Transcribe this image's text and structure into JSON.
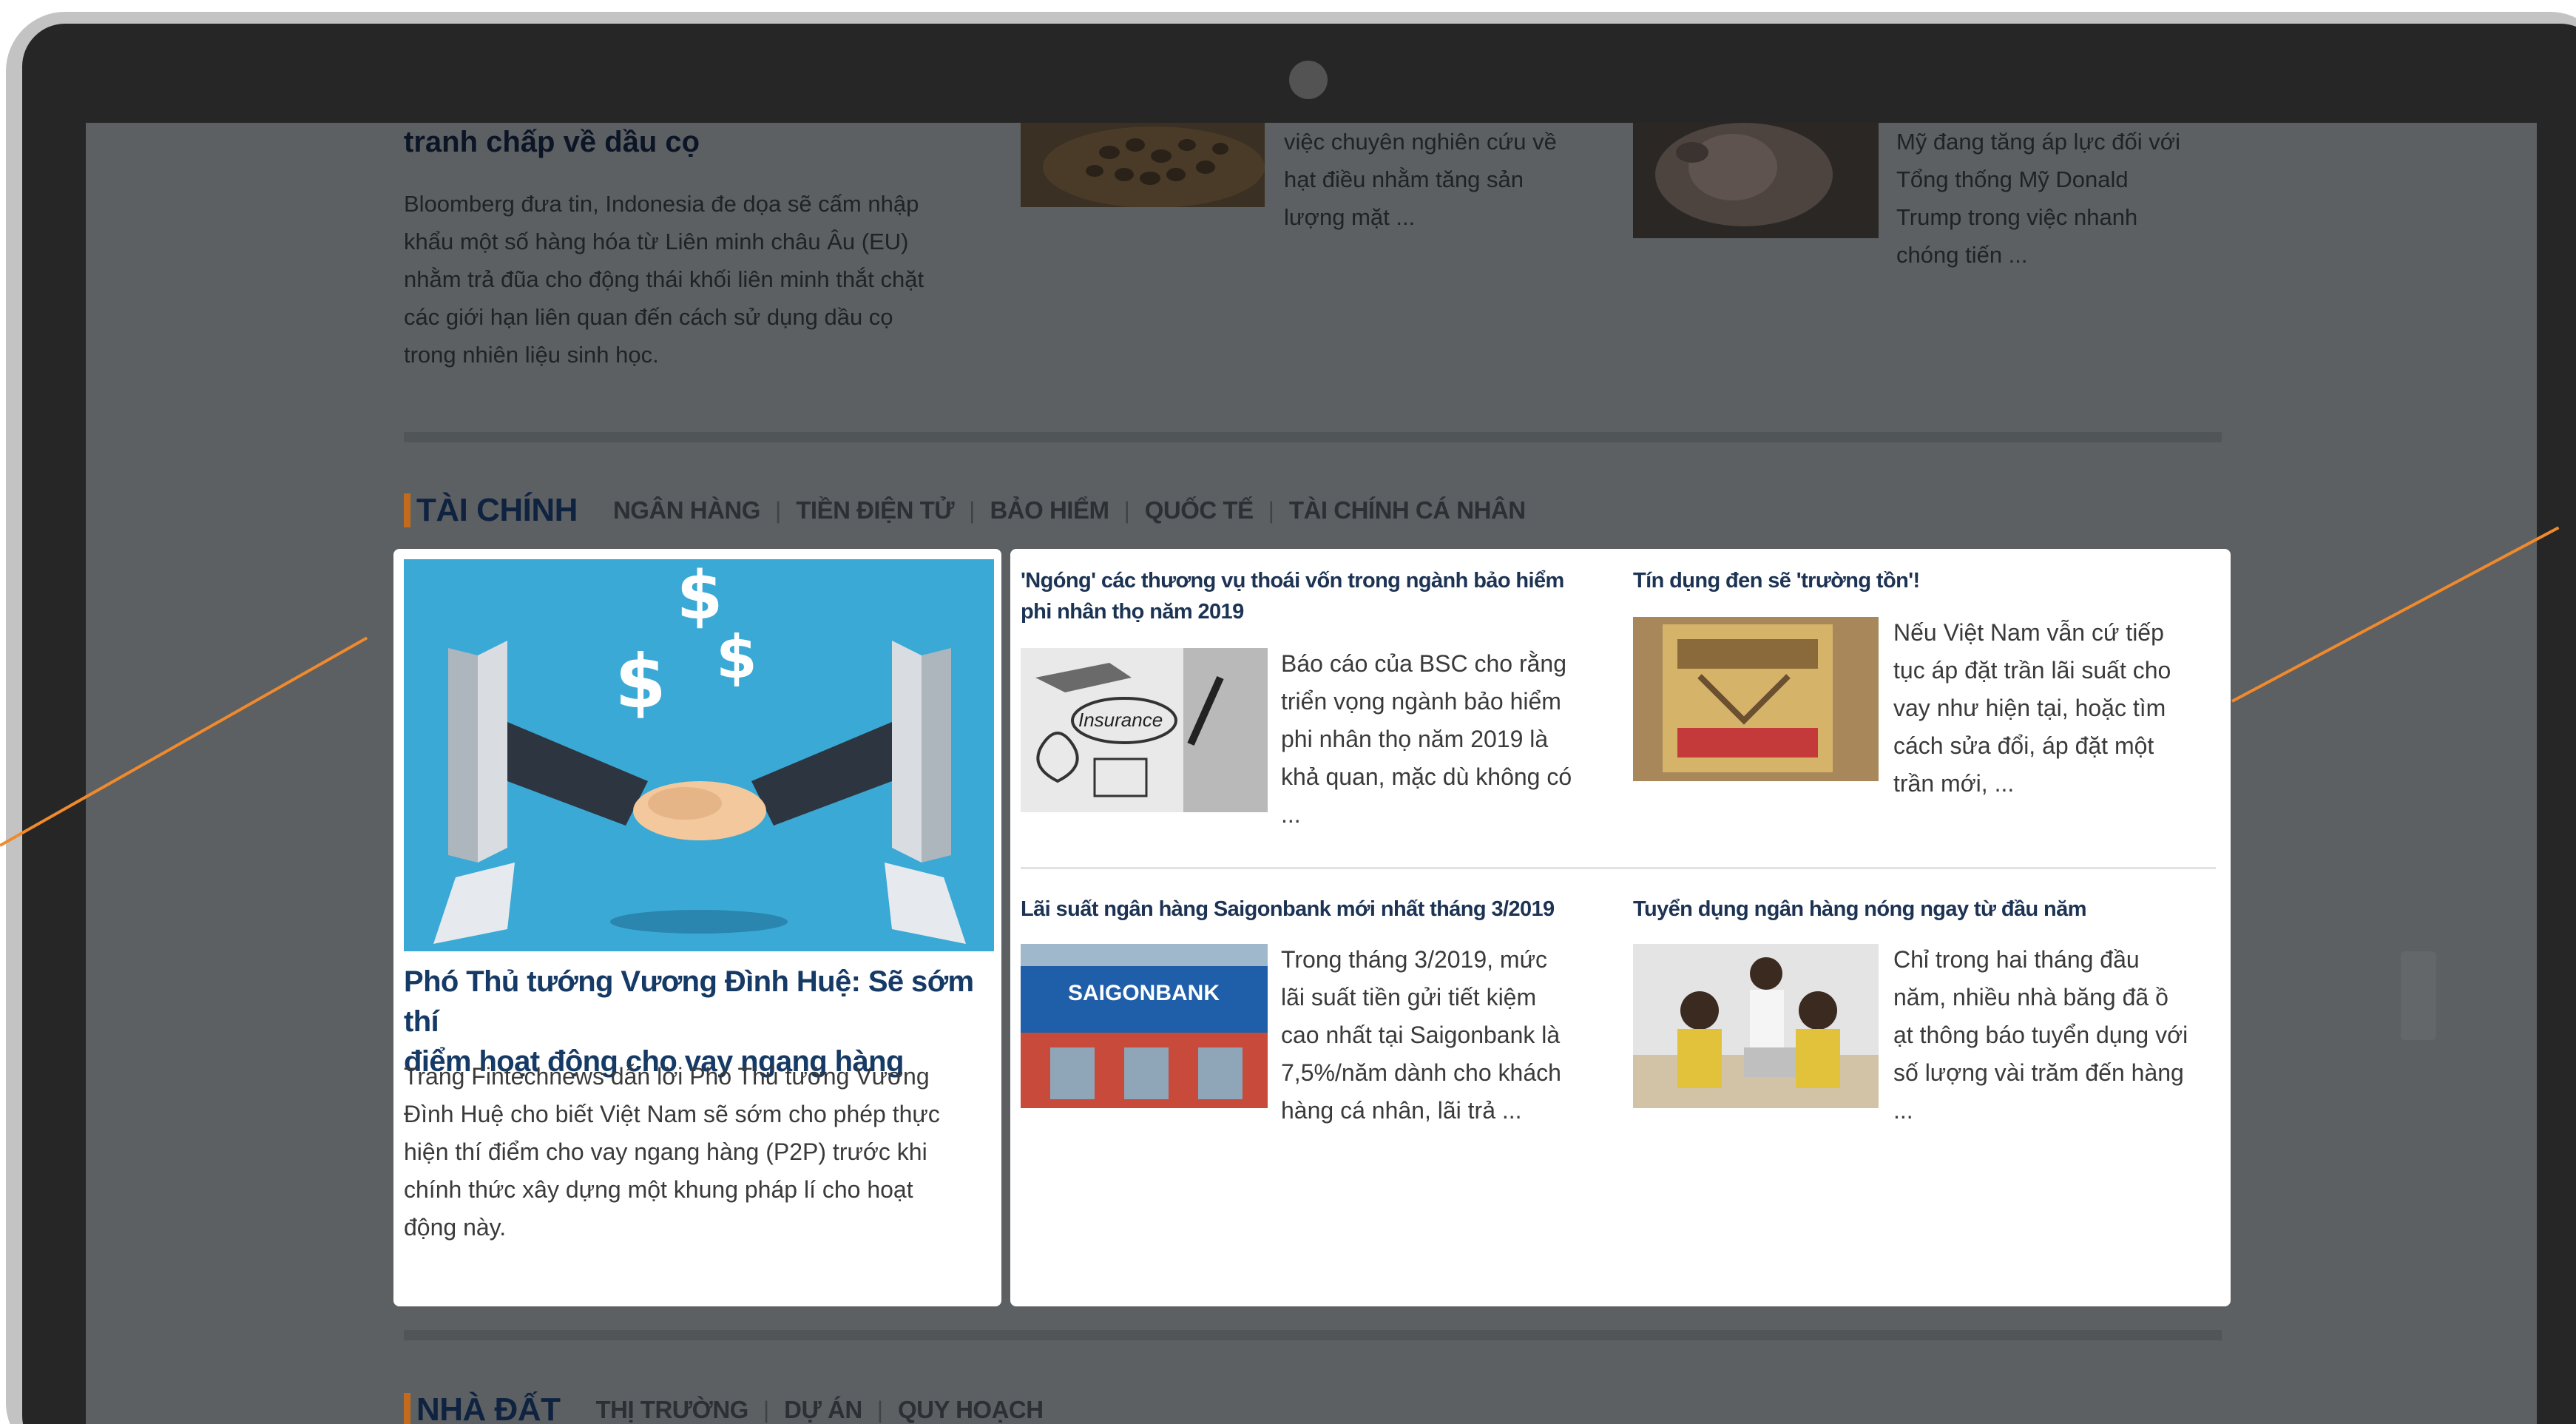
{
  "top_section": {
    "article_left": {
      "title": "tranh chấp về dầu cọ",
      "summary_lines": [
        "Bloomberg đưa tin, Indonesia đe dọa sẽ cấm nhập",
        "khẩu một số hàng hóa từ Liên minh châu Âu (EU)",
        "nhằm trả đũa cho động thái khối liên minh thắt chặt",
        "các giới hạn liên quan đến cách sử dụng dầu cọ",
        "trong nhiên liệu sinh học."
      ]
    },
    "article_middle": {
      "summary_lines": [
        "việc chuyên nghiên cứu về",
        "hạt điều nhằm tăng sản",
        "lượng mặt ..."
      ]
    },
    "article_right": {
      "summary_lines": [
        "Mỹ đang tăng áp lực đối với",
        "Tổng thống Mỹ Donald",
        "Trump trong việc nhanh",
        "chóng tiến ..."
      ]
    }
  },
  "finance_section": {
    "category": "TÀI CHÍNH",
    "subcategories": [
      "NGÂN HÀNG",
      "TIỀN ĐIỆN TỬ",
      "BẢO HIỂM",
      "QUỐC TẾ",
      "TÀI CHÍNH CÁ NHÂN"
    ],
    "featured": {
      "title_lines": [
        "Phó Thủ tướng Vương Đình Huệ: Sẽ sớm thí",
        "điểm hoạt động cho vay ngang hàng"
      ],
      "summary_lines": [
        "Trang Fintechnews dẫn lời Phó Thủ tướng Vương",
        "Đình Huệ cho biết Việt Nam sẽ sớm cho phép thực",
        "hiện thí điểm cho vay ngang hàng (P2P) trước khi",
        "chính thức xây dựng một khung pháp lí cho hoạt",
        "động này."
      ]
    },
    "articles": [
      {
        "title_lines": [
          "'Ngóng' các thương vụ thoái vốn trong ngành bảo hiểm",
          "phi nhân thọ năm 2019"
        ],
        "summary_lines": [
          "Báo cáo của BSC cho rằng",
          "triển vọng ngành bảo hiểm",
          "phi nhân thọ năm 2019 là",
          "khả quan, mặc dù không có",
          "..."
        ],
        "thumb_label": "Insurance"
      },
      {
        "title_lines": [
          "Tín dụng đen sẽ 'trường tồn'!"
        ],
        "summary_lines": [
          "Nếu Việt Nam vẫn cứ tiếp",
          "tục áp đặt trần lãi suất cho",
          "vay như hiện tại, hoặc tìm",
          "cách sửa đổi, áp đặt một",
          "trần mới, ..."
        ]
      },
      {
        "title_lines": [
          "Lãi suất ngân hàng Saigonbank mới nhất tháng 3/2019"
        ],
        "summary_lines": [
          "Trong tháng 3/2019, mức",
          "lãi suất tiền gửi tiết kiệm",
          "cao nhất tại Saigonbank là",
          "7,5%/năm dành cho khách",
          "hàng cá nhân, lãi trả ..."
        ],
        "thumb_label": "SAIGONBANK"
      },
      {
        "title_lines": [
          "Tuyển dụng ngân hàng nóng ngay từ đầu năm"
        ],
        "summary_lines": [
          "Chỉ trong hai tháng đầu",
          "năm, nhiều nhà băng đã ồ",
          "ạt thông báo tuyển dụng với",
          "số lượng vài trăm đến hàng",
          "..."
        ]
      }
    ]
  },
  "real_estate_section": {
    "category": "NHÀ ĐẤT",
    "subcategories": [
      "THỊ TRƯỜNG",
      "DỰ ÁN",
      "QUY HOẠCH"
    ]
  },
  "colors": {
    "accent": "#f08a2c",
    "category_marker": "#c36a1c",
    "title_blue": "#1c3354",
    "frame": "#262626",
    "overlay": "#5c6063"
  }
}
